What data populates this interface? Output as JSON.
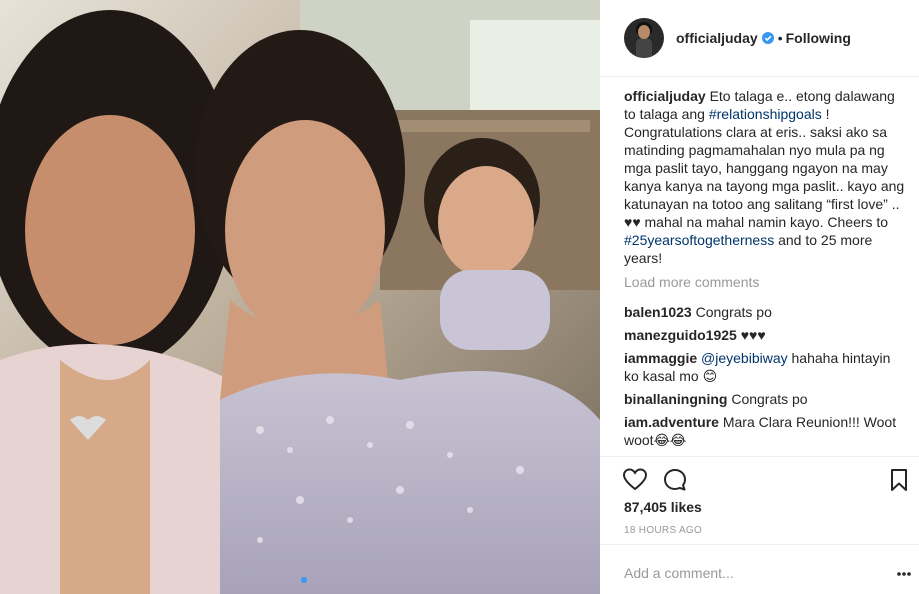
{
  "post": {
    "username": "officialjuday",
    "follow_status": "Following",
    "separator": "•",
    "caption": {
      "author": "officialjuday",
      "text_1": " Eto talaga e.. etong dalawang to talaga ang ",
      "tag_1": "#relationshipgoals",
      "text_2": " ! Congratulations clara at eris.. saksi ako sa matinding pagmamahalan nyo mula pa ng mga paslit tayo, hanggang ngayon na may kanya kanya na tayong mga paslit.. kayo ang katunayan na totoo ang salitang “first love” .. ♥♥ mahal na mahal namin kayo. Cheers to ",
      "tag_2": "#25yearsoftogetherness",
      "text_3": " and to 25 more years!"
    },
    "load_more": "Load more comments",
    "comments": [
      {
        "user": "balen1023",
        "text": "Congrats po"
      },
      {
        "user": "manezguido1925",
        "text": "♥♥♥"
      },
      {
        "user": "iammaggie",
        "mention": "@jeyebibiway",
        "text": " hahaha hintayin ko kasal mo 😊"
      },
      {
        "user": "binallaningning",
        "text": "Congrats po"
      },
      {
        "user": "iam.adventure",
        "text": "Mara Clara Reunion!!! Woot woot😂😂"
      }
    ],
    "likes": "87,405 likes",
    "time": "18 HOURS AGO",
    "add_comment_placeholder": "Add a comment...",
    "icons": {
      "like": "heart-icon",
      "comment": "comment-icon",
      "save": "bookmark-icon",
      "verified": "verified-badge-icon",
      "more": "more-options-icon"
    },
    "colors": {
      "link": "#003569",
      "verified": "#3897f0",
      "muted": "#999999",
      "carousel_dot": "#3897f0"
    }
  }
}
